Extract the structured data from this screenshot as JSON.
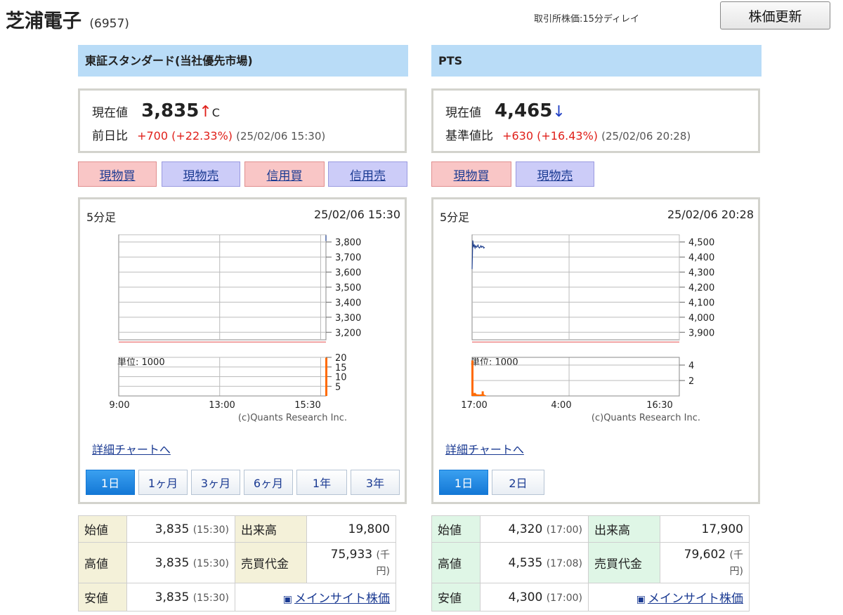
{
  "header": {
    "company_name": "芝浦電子",
    "stock_code": "(6957)",
    "delay_note": "取引所株価:15分ディレイ",
    "refresh_label": "株価更新"
  },
  "colors": {
    "market_header_bg": "#b9dcf7",
    "price_up": "#e0201a",
    "price_down": "#1f3ec4",
    "buy_button_bg": "#f9c6c6",
    "sell_button_bg": "#ccccf8",
    "active_range_bg": "#1478d6",
    "volume_bar": "#ff6a00",
    "price_line": "#1b3c8c"
  },
  "left": {
    "market_name": "東証スタンダード(当社優先市場)",
    "price_label": "現在値",
    "price": "3,835",
    "arrow": "↑",
    "flag": "C",
    "change_label": "前日比",
    "change": "+700",
    "change_pct": "(+22.33%)",
    "timestamp": "(25/02/06 15:30)",
    "trade_buttons": [
      "現物買",
      "現物売",
      "信用買",
      "信用売"
    ],
    "chart_label": "5分足",
    "chart_date": "25/02/06 15:30",
    "chart_credit": "(c)Quants Research Inc.",
    "detail_link": "詳細チャートへ",
    "ranges": [
      "1日",
      "1ヶ月",
      "3ヶ月",
      "6ヶ月",
      "1年",
      "3年"
    ],
    "active_range": "1日",
    "stats": {
      "open_label": "始値",
      "open": "3,835",
      "open_time": "(15:30)",
      "high_label": "高値",
      "high": "3,835",
      "high_time": "(15:30)",
      "low_label": "安値",
      "low": "3,835",
      "low_time": "(15:30)",
      "volume_label": "出来高",
      "volume": "19,800",
      "turnover_label": "売買代金",
      "turnover": "75,933",
      "turnover_unit_a": "(千",
      "turnover_unit_b": "円)",
      "main_site_link": "メインサイト株価"
    }
  },
  "right": {
    "market_name": "PTS",
    "price_label": "現在値",
    "price": "4,465",
    "arrow": "↓",
    "change_label": "基準値比",
    "change": "+630",
    "change_pct": "(+16.43%)",
    "timestamp": "(25/02/06 20:28)",
    "trade_buttons": [
      "現物買",
      "現物売"
    ],
    "chart_label": "5分足",
    "chart_date": "25/02/06 20:28",
    "chart_credit": "(c)Quants Research Inc.",
    "detail_link": "詳細チャートへ",
    "ranges": [
      "1日",
      "2日"
    ],
    "active_range": "1日",
    "stats": {
      "open_label": "始値",
      "open": "4,320",
      "open_time": "(17:00)",
      "high_label": "高値",
      "high": "4,535",
      "high_time": "(17:08)",
      "low_label": "安値",
      "low": "4,300",
      "low_time": "(17:00)",
      "volume_label": "出来高",
      "volume": "17,900",
      "turnover_label": "売買代金",
      "turnover": "79,602",
      "turnover_unit_a": "(千",
      "turnover_unit_b": "円)",
      "main_site_link": "メインサイト株価"
    }
  },
  "chart_data": [
    {
      "type": "line",
      "title": "5分足",
      "y_ticks": [
        "3,800",
        "3,700",
        "3,600",
        "3,500",
        "3,400",
        "3,300",
        "3,200"
      ],
      "ylim": [
        3150,
        3850
      ],
      "x_ticks": [
        "9:00",
        "13:00",
        "15:30"
      ],
      "reference_line": 3135,
      "series": [
        {
          "x": [
            "15:30"
          ],
          "values": [
            3835
          ]
        }
      ],
      "volume": {
        "unit_label": "単位: 1000",
        "y_ticks": [
          "20",
          "15",
          "10",
          "5"
        ],
        "ylim": [
          0,
          20
        ],
        "x": [
          "15:30"
        ],
        "values": [
          19.8
        ]
      }
    },
    {
      "type": "line",
      "title": "5分足",
      "y_ticks": [
        "4,500",
        "4,400",
        "4,300",
        "4,200",
        "4,100",
        "4,000",
        "3,900"
      ],
      "ylim": [
        3850,
        4550
      ],
      "x_ticks": [
        "17:00",
        "4:00",
        "16:30"
      ],
      "reference_line": 3835,
      "series": [
        {
          "x": [
            "17:00",
            "17:05",
            "17:10",
            "17:15",
            "17:20",
            "17:25",
            "17:30",
            "17:35",
            "17:40",
            "17:45",
            "17:50",
            "17:55",
            "18:00",
            "18:05",
            "18:10",
            "18:15",
            "18:20",
            "18:25"
          ],
          "values": [
            4320,
            4510,
            4470,
            4480,
            4460,
            4475,
            4465,
            4470,
            4480,
            4465,
            4460,
            4465,
            4475,
            4465,
            4470,
            4470,
            4460,
            4465
          ]
        }
      ],
      "volume": {
        "unit_label": "単位: 1000",
        "y_ticks": [
          "4",
          "2"
        ],
        "ylim": [
          0,
          5
        ],
        "x": [
          "17:00",
          "17:05",
          "17:10",
          "17:15",
          "17:20",
          "17:25",
          "17:30",
          "17:35",
          "17:40",
          "17:45",
          "17:50",
          "17:55",
          "18:00",
          "18:05",
          "18:10",
          "18:15",
          "18:20",
          "18:25"
        ],
        "values": [
          4.6,
          0.3,
          0.2,
          0.4,
          0.3,
          0.2,
          0.2,
          0.1,
          0.2,
          0.1,
          0.1,
          0.2,
          0.1,
          0.2,
          0.6,
          0.2,
          0.1,
          0.1
        ]
      }
    }
  ]
}
